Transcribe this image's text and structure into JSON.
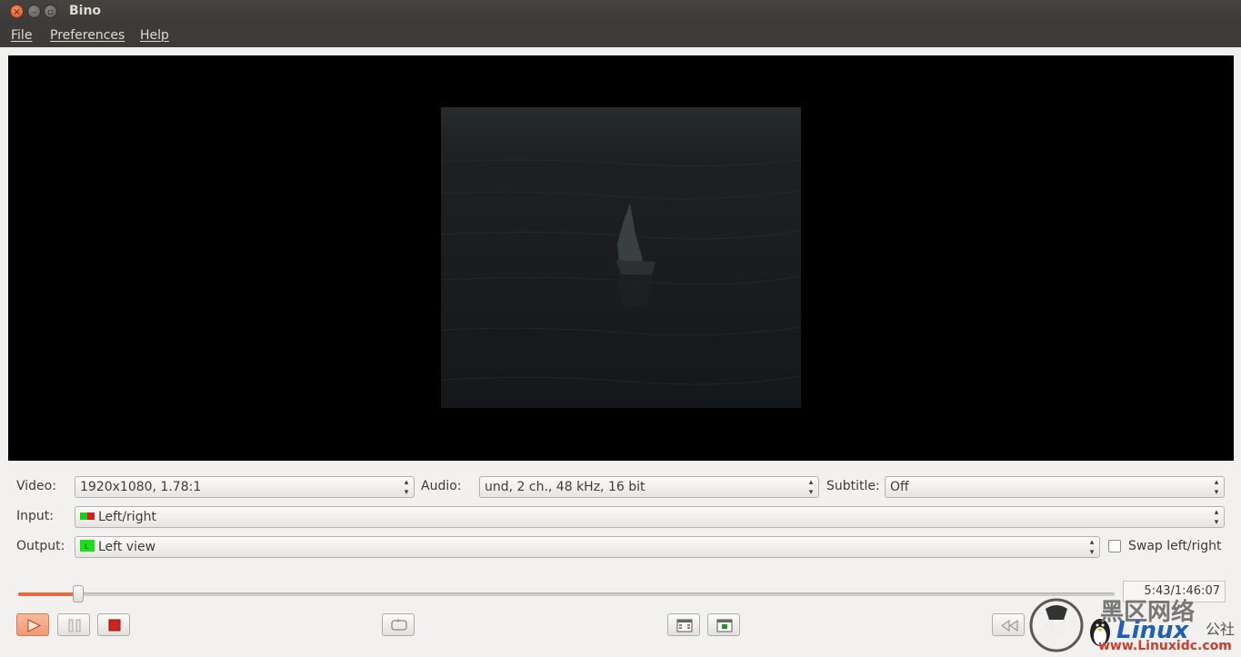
{
  "window": {
    "title": "Bino"
  },
  "menubar": {
    "items": [
      "File",
      "Preferences",
      "Help"
    ]
  },
  "controls": {
    "video": {
      "label": "Video:",
      "value": "1920x1080, 1.78:1"
    },
    "audio": {
      "label": "Audio:",
      "value": "und, 2 ch., 48 kHz, 16 bit"
    },
    "subtitle": {
      "label": "Subtitle:",
      "value": "Off"
    },
    "input": {
      "label": "Input:",
      "value": "Left/right"
    },
    "output": {
      "label": "Output:",
      "value": "Left view"
    },
    "swap": {
      "label": "Swap left/right",
      "checked": false
    }
  },
  "playback": {
    "progress_fraction": 0.055,
    "time": "5:43/1:46:07",
    "accent_color": "#e8693b"
  },
  "buttons": {
    "play": "play-icon",
    "pause": "pause-icon",
    "stop": "stop-icon",
    "loop": "loop-icon",
    "fullscreen": "fullscreen-icon",
    "center": "center-icon",
    "rewind": "rewind-icon"
  },
  "watermark": {
    "line1": "黑区网络",
    "brand": "Linux",
    "sub": "公社",
    "url": "www.Linuxidc.com"
  }
}
